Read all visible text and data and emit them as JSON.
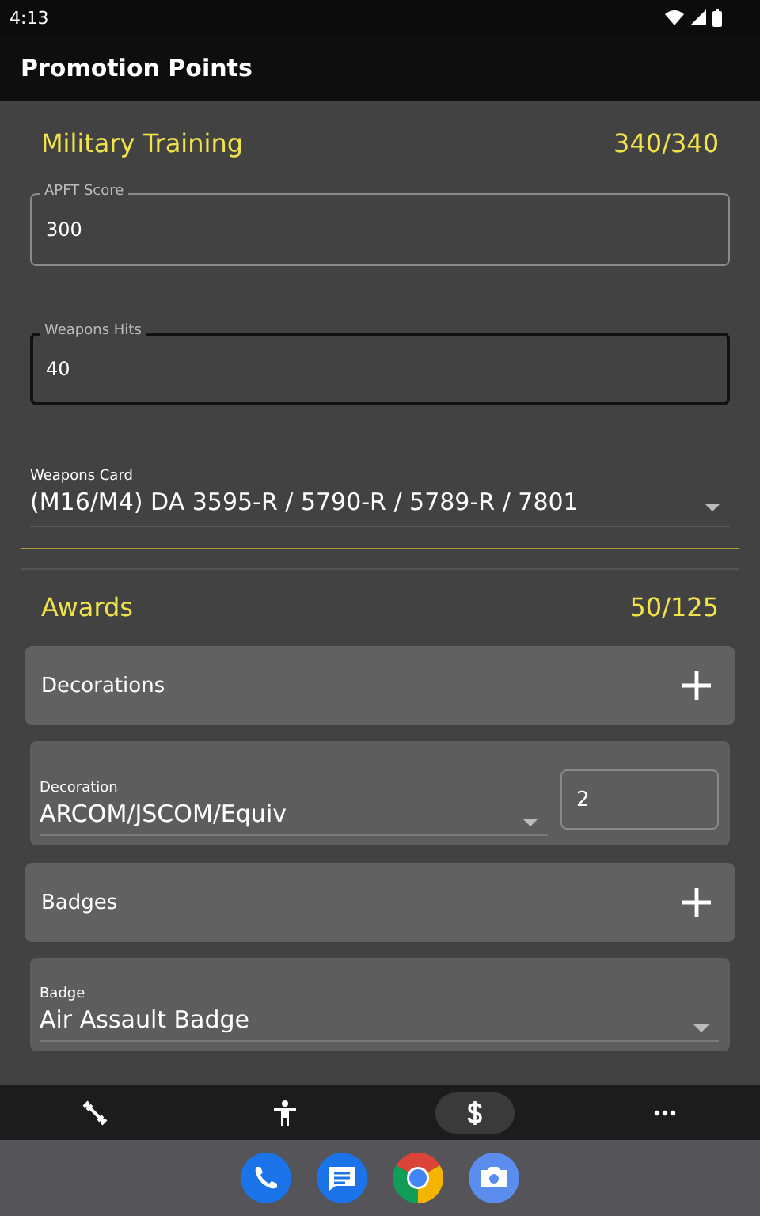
{
  "status_bar": {
    "time": "4:13"
  },
  "app_bar": {
    "title": "Promotion Points"
  },
  "military_training": {
    "title": "Military Training",
    "score": "340/340",
    "fields": [
      {
        "label": "APFT Score",
        "value": "300",
        "focused": false
      },
      {
        "label": "Weapons Hits",
        "value": "40",
        "focused": true
      }
    ],
    "weapons_card": {
      "label": "Weapons Card",
      "value": "(M16/M4) DA 3595-R / 5790-R / 5789-R / 7801"
    }
  },
  "awards": {
    "title": "Awards",
    "score": "50/125",
    "groups": [
      {
        "title": "Decorations",
        "entry": {
          "label": "Decoration",
          "value": "ARCOM/JSCOM/Equiv",
          "count": "2"
        }
      },
      {
        "title": "Badges",
        "entry": {
          "label": "Badge",
          "value": "Air Assault Badge"
        }
      }
    ]
  },
  "bottom_nav": [
    {
      "kind": "fitness",
      "selected": false
    },
    {
      "kind": "person",
      "selected": false
    },
    {
      "kind": "dollar",
      "selected": true
    },
    {
      "kind": "more",
      "selected": false
    }
  ],
  "dock": [
    {
      "kind": "phone"
    },
    {
      "kind": "messages"
    },
    {
      "kind": "browser"
    },
    {
      "kind": "camera"
    }
  ]
}
